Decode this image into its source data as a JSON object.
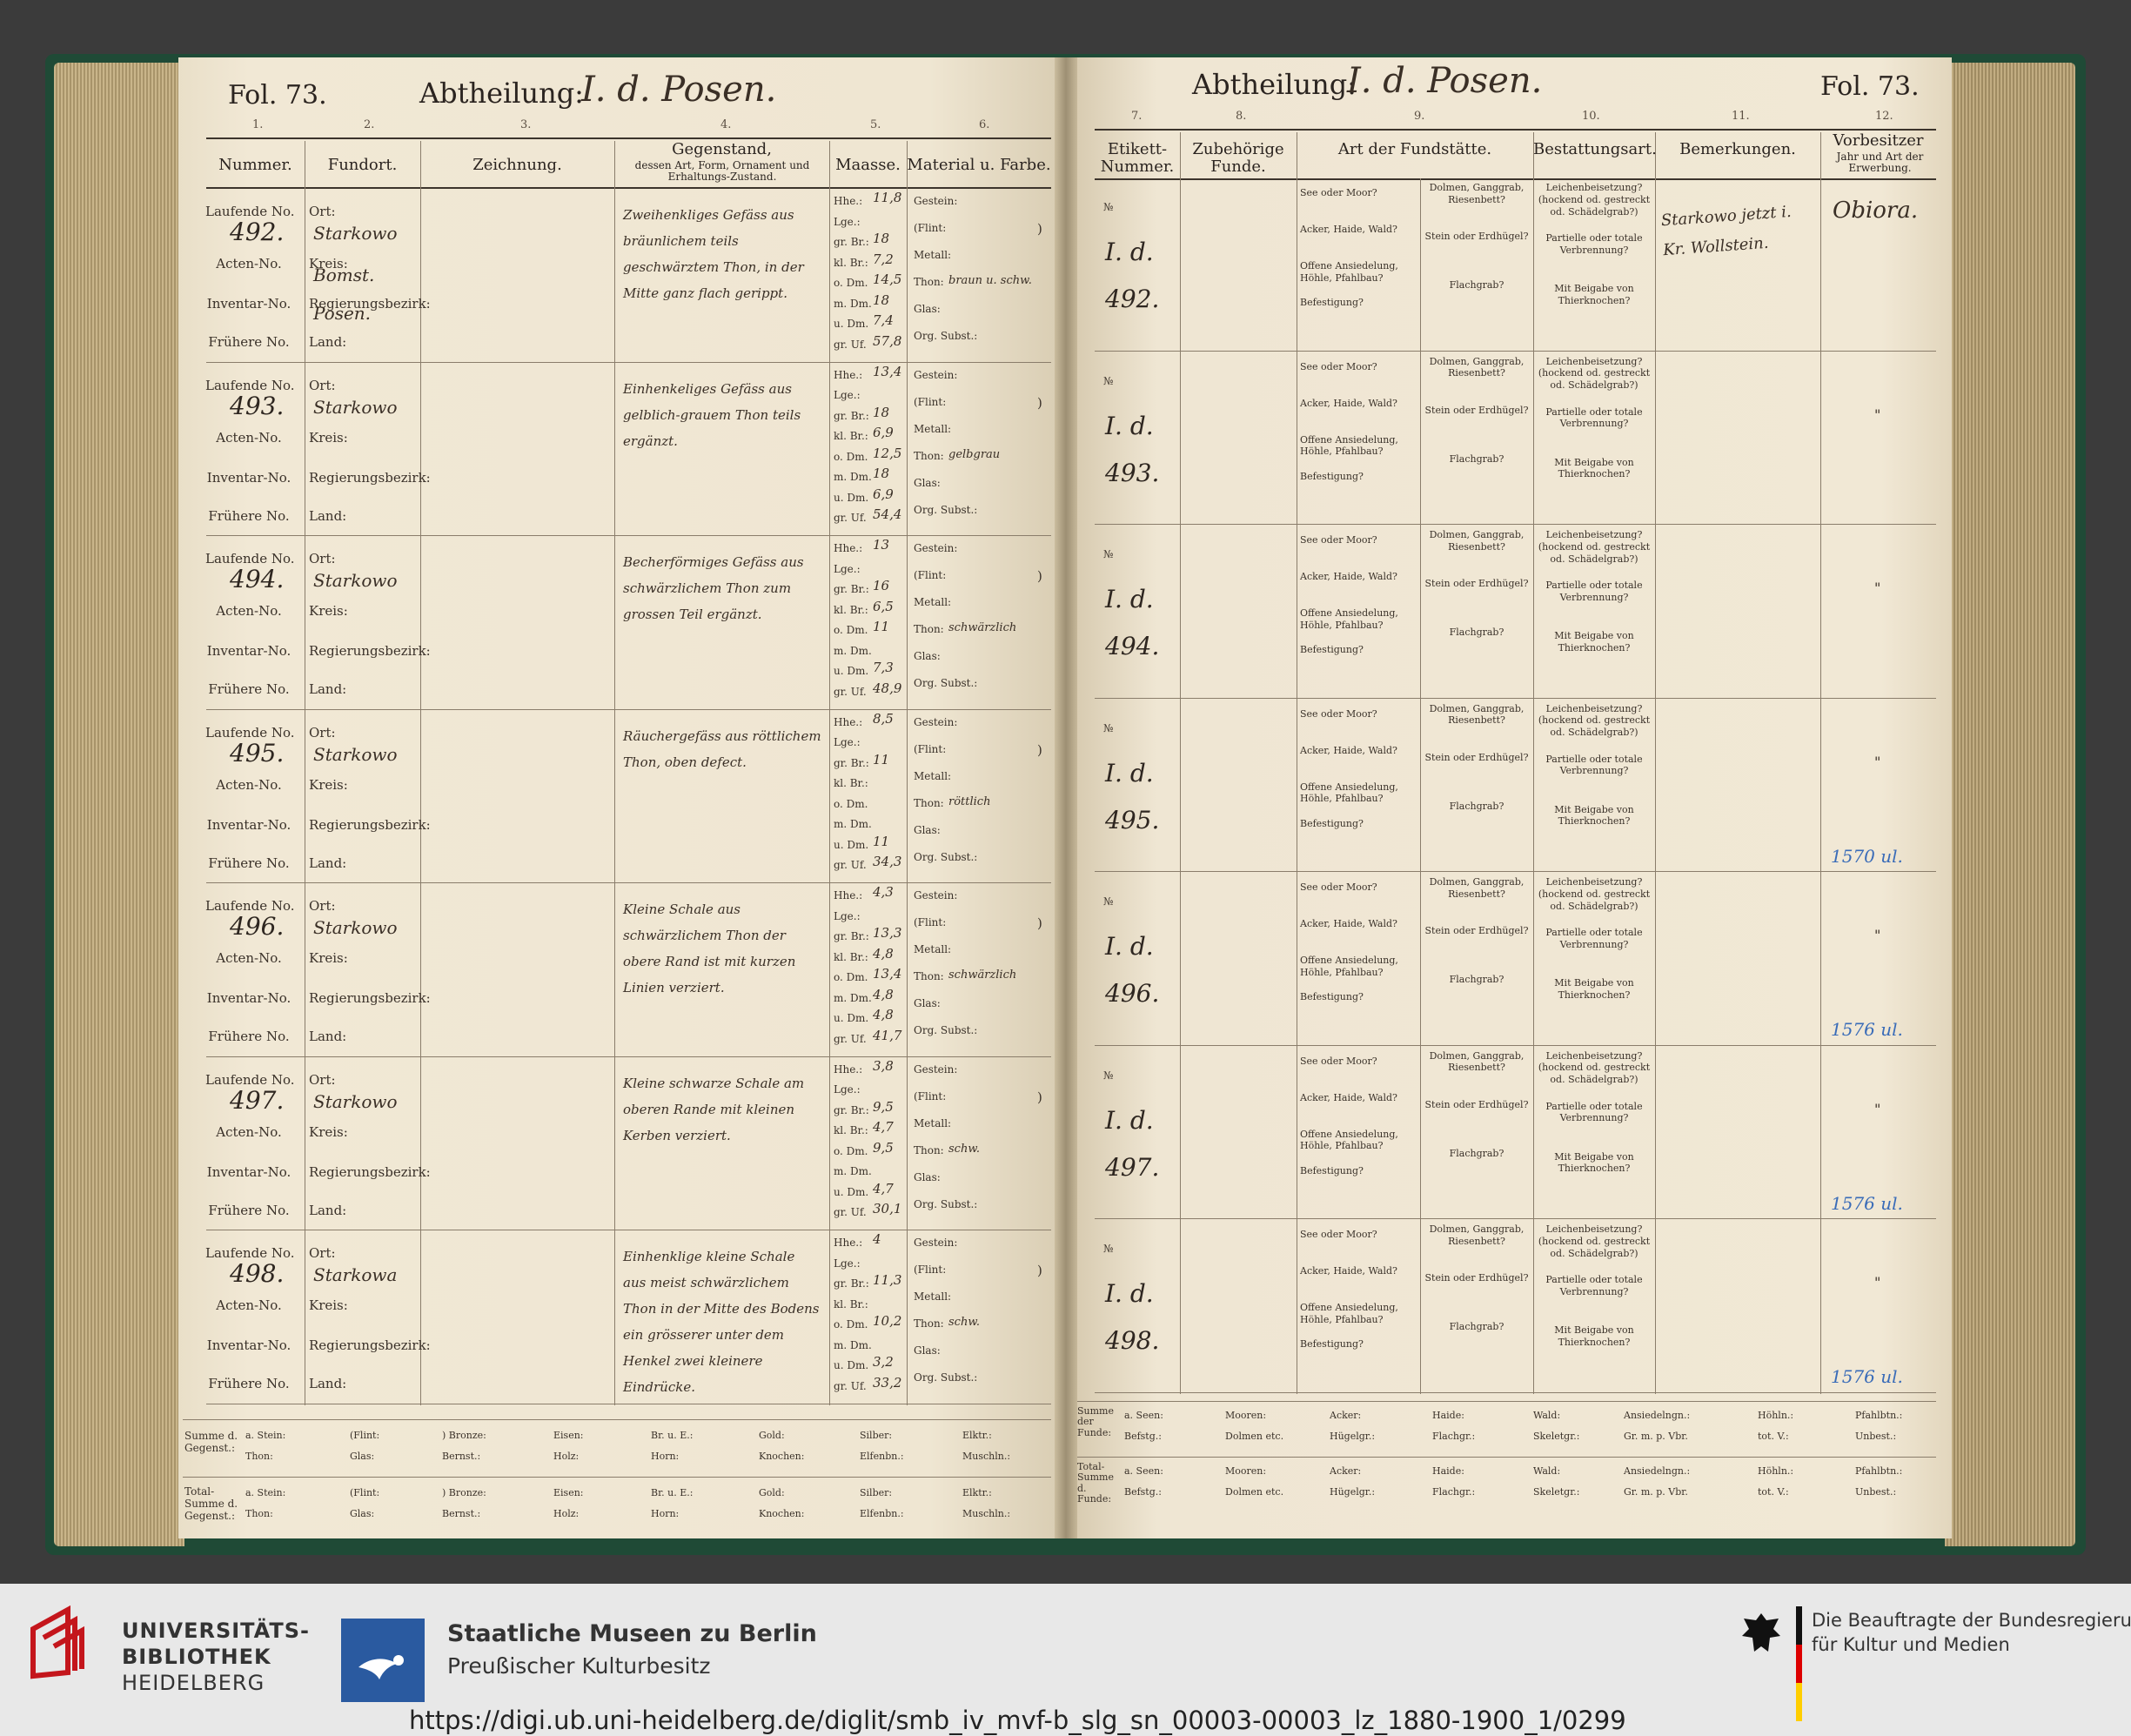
{
  "left_page": {
    "fol": "Fol. 73.",
    "abtheilung_label": "Abtheilung:",
    "abtheilung_value": "I. d. Posen.",
    "column_numbers": [
      "1.",
      "2.",
      "3.",
      "4.",
      "5.",
      "6."
    ],
    "headers": {
      "nummer": "Nummer.",
      "fundort": "Fundort.",
      "zeichnung": "Zeichnung.",
      "gegenstand": "Gegenstand,",
      "gegenstand_sub": "dessen Art, Form, Ornament und Erhaltungs-Zustand.",
      "maasse": "Maasse.",
      "material": "Material u. Farbe."
    },
    "row_labels": {
      "laufende": "Laufende No.",
      "acten": "Acten-No.",
      "inventar": "Inventar-No.",
      "fruehere": "Frühere No.",
      "ort": "Ort:",
      "kreis": "Kreis:",
      "regbez": "Regierungsbezirk:",
      "land": "Land:",
      "hhe": "Hhe.:",
      "lge": "Lge.:",
      "grbr": "gr. Br.:",
      "klbr": "kl. Br.:",
      "odm": "o. Dm.",
      "mdm": "m. Dm.",
      "udm": "u. Dm.",
      "gruf": "gr. Uf.",
      "gestein": "Gestein:",
      "flint": "(Flint:",
      "metall": "Metall:",
      "thon": "Thon:",
      "glas": "Glas:",
      "orgsubst": "Org. Subst.:"
    },
    "rows": [
      {
        "nr": "492.",
        "ort": "Starkowo",
        "kreis": "Bomst.",
        "regbez": "Posen.",
        "desc": "Zweihenkliges Gefäss aus bräunlichem teils geschwärztem Thon, in der Mitte ganz flach gerippt.",
        "hhe": "11,8",
        "grbr": "18",
        "klbr": "7,2",
        "odm": "14,5",
        "mdm": "18",
        "udm": "7,4",
        "gruf": "57,8",
        "thon": "braun u. schw."
      },
      {
        "nr": "493.",
        "ort": "Starkowo",
        "kreis": "",
        "regbez": "",
        "desc": "Einhenkeliges Gefäss aus gelblich-grauem Thon teils ergänzt.",
        "hhe": "13,4",
        "grbr": "18",
        "klbr": "6,9",
        "odm": "12,5",
        "mdm": "18",
        "udm": "6,9",
        "gruf": "54,4",
        "thon": "gelbgrau"
      },
      {
        "nr": "494.",
        "ort": "Starkowo",
        "kreis": "",
        "regbez": "",
        "desc": "Becherförmiges Gefäss aus schwärzlichem Thon zum grossen Teil ergänzt.",
        "hhe": "13",
        "grbr": "16",
        "klbr": "6,5",
        "odm": "11",
        "mdm": "",
        "udm": "7,3",
        "gruf": "48,9",
        "thon": "schwärzlich"
      },
      {
        "nr": "495.",
        "ort": "Starkowo",
        "kreis": "",
        "regbez": "",
        "desc": "Räuchergefäss aus röttlichem Thon, oben defect.",
        "hhe": "8,5",
        "grbr": "11",
        "klbr": "",
        "odm": "",
        "mdm": "",
        "udm": "11",
        "gruf": "34,3",
        "thon": "röttlich"
      },
      {
        "nr": "496.",
        "ort": "Starkowo",
        "kreis": "",
        "regbez": "",
        "desc": "Kleine Schale aus schwärzlichem Thon der obere Rand ist mit kurzen Linien verziert.",
        "hhe": "4,3",
        "grbr": "13,3",
        "klbr": "4,8",
        "odm": "13,4",
        "mdm": "4,8",
        "udm": "4,8",
        "gruf": "41,7",
        "thon": "schwärzlich"
      },
      {
        "nr": "497.",
        "ort": "Starkowo",
        "kreis": "",
        "regbez": "",
        "desc": "Kleine schwarze Schale am oberen Rande mit kleinen Kerben verziert.",
        "hhe": "3,8",
        "grbr": "9,5",
        "klbr": "4,7",
        "odm": "9,5",
        "mdm": "",
        "udm": "4,7",
        "gruf": "30,1",
        "thon": "schw."
      },
      {
        "nr": "498.",
        "ort": "Starkowa",
        "kreis": "",
        "regbez": "",
        "desc": "Einhenklige kleine Schale aus meist schwärzlichem Thon in der Mitte des Bodens ein grösserer unter dem Henkel zwei kleinere Eindrücke.",
        "hhe": "4",
        "grbr": "11,3",
        "klbr": "",
        "odm": "10,2",
        "mdm": "",
        "udm": "3,2",
        "gruf": "33,2",
        "thon": "schw."
      }
    ],
    "summe_label": "Summe d. Gegenst.:",
    "total_label": "Total-Summe d. Gegenst.:",
    "summe_row1": [
      "a. Stein:",
      "(Flint:",
      ") Bronze:",
      "Eisen:",
      "Br. u. E.:",
      "Gold:",
      "Silber:",
      "Elktr.:"
    ],
    "summe_row2": [
      "Thon:",
      "Glas:",
      "Bernst.:",
      "Holz:",
      "Horn:",
      "Knochen:",
      "Elfenbn.:",
      "Muschln.:"
    ]
  },
  "right_page": {
    "fol": "Fol. 73.",
    "abtheilung_label": "Abtheilung:",
    "abtheilung_value": "I. d. Posen.",
    "column_numbers": [
      "7.",
      "8.",
      "9.",
      "10.",
      "11.",
      "12."
    ],
    "headers": {
      "etikett": "Etikett-Nummer.",
      "zubehoerige": "Zubehörige Funde.",
      "fundstaette": "Art der Fundstätte.",
      "bestattung": "Bestattungsart.",
      "bemerkungen": "Bemerkungen.",
      "vorbesitzer": "Vorbesitzer",
      "vorbesitzer_sub": "Jahr und Art der Erwerbung."
    },
    "fundstaette_labels": [
      "See oder Moor?",
      "Acker, Haide, Wald?",
      "Offene Ansiedelung, Höhle, Pfahlbau?",
      "Befestigung?"
    ],
    "grab_labels": [
      "Dolmen, Ganggrab, Riesenbett?",
      "Stein oder Erdhügel?",
      "Flachgrab?"
    ],
    "bestattung_labels": [
      "Leichenbeisetzung? (hockend od. gestreckt od. Schädelgrab?)",
      "Partielle oder totale Verbrennung?",
      "Mit Beigabe von Thierknochen?"
    ],
    "rows": [
      {
        "etikett": "I. d. 492.",
        "bemerkung": "Starkowo jetzt i. Kr. Wollstein.",
        "vorbesitzer": "Obiora.",
        "note": ""
      },
      {
        "etikett": "I. d. 493.",
        "bemerkung": "",
        "vorbesitzer": "\"",
        "note": ""
      },
      {
        "etikett": "I. d. 494.",
        "bemerkung": "",
        "vorbesitzer": "\"",
        "note": ""
      },
      {
        "etikett": "I. d. 495.",
        "bemerkung": "",
        "vorbesitzer": "\"",
        "note": "1570 ul."
      },
      {
        "etikett": "I. d. 496.",
        "bemerkung": "",
        "vorbesitzer": "\"",
        "note": "1576 ul."
      },
      {
        "etikett": "I. d. 497.",
        "bemerkung": "",
        "vorbesitzer": "\"",
        "note": "1576 ul."
      },
      {
        "etikett": "I. d. 498.",
        "bemerkung": "",
        "vorbesitzer": "\"",
        "note": "1576 ul."
      }
    ],
    "no_mark": "№",
    "summe_label": "Summe der Funde:",
    "total_label": "Total-Summe d. Funde:",
    "summe_row1": [
      "a. Seen:",
      "Mooren:",
      "Acker:",
      "Haide:",
      "Wald:",
      "Ansiedelngn.:",
      "Höhln.:",
      "Pfahlbtn.:"
    ],
    "summe_row2": [
      "Befstg.:",
      "Dolmen etc.",
      "Hügelgr.:",
      "Flachgr.:",
      "Skeletgr.:",
      "Gr. m. p. Vbr.",
      "tot. V.:",
      "Unbest.:"
    ]
  },
  "footer": {
    "ub_line1": "UNIVERSITÄTS-",
    "ub_line2": "BIBLIOTHEK",
    "ub_line3": "HEIDELBERG",
    "smb_line1": "Staatliche Museen zu Berlin",
    "smb_line2": "Preußischer Kulturbesitz",
    "bkm_line1": "Die Beauftragte der Bundesregierung",
    "bkm_line2": "für Kultur und Medien",
    "url": "https://digi.ub.uni-heidelberg.de/diglit/smb_iv_mvf-b_slg_sn_00003-00003_lz_1880-1900_1/0299"
  },
  "colors": {
    "ub_red": "#c4161c",
    "smb_blue": "#2a5aa0",
    "ink_blue": "#3a6cb8"
  }
}
